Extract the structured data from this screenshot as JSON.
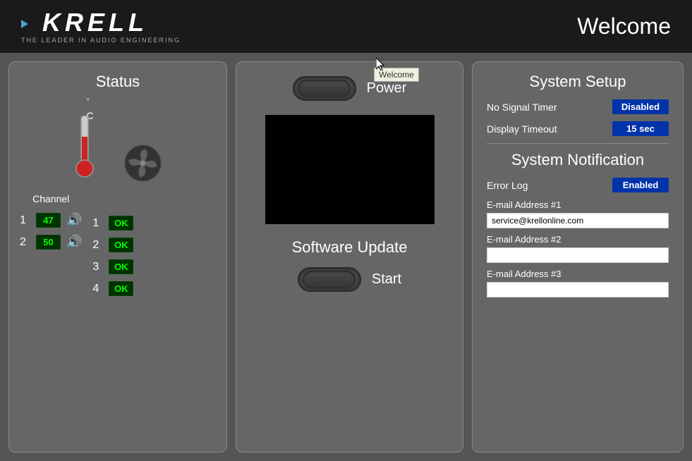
{
  "header": {
    "logo_text": "KRELL",
    "logo_subtitle": "THE LEADER IN AUDIO ENGINEERING",
    "title": "Welcome"
  },
  "tooltip": {
    "text": "Welcome"
  },
  "status": {
    "title": "Status",
    "temp_unit": "C",
    "channels": [
      {
        "num": "1",
        "temp": "47",
        "has_speaker": true
      },
      {
        "num": "2",
        "temp": "50",
        "has_speaker": true
      }
    ],
    "outputs": [
      {
        "num": "1",
        "status": "OK"
      },
      {
        "num": "2",
        "status": "OK"
      },
      {
        "num": "3",
        "status": "OK"
      },
      {
        "num": "4",
        "status": "OK"
      }
    ],
    "channel_label": "Channel"
  },
  "center": {
    "power_label": "Power",
    "software_update_title": "Software Update",
    "start_label": "Start"
  },
  "system_setup": {
    "title": "System Setup",
    "no_signal_timer_label": "No Signal Timer",
    "no_signal_timer_value": "Disabled",
    "display_timeout_label": "Display Timeout",
    "display_timeout_value": "15 sec",
    "notification_title": "System Notification",
    "error_log_label": "Error Log",
    "error_log_value": "Enabled",
    "email1_label": "E-mail Address #1",
    "email1_value": "service@krellonline.com",
    "email2_label": "E-mail Address #2",
    "email2_value": "",
    "email3_label": "E-mail Address #3",
    "email3_value": ""
  }
}
